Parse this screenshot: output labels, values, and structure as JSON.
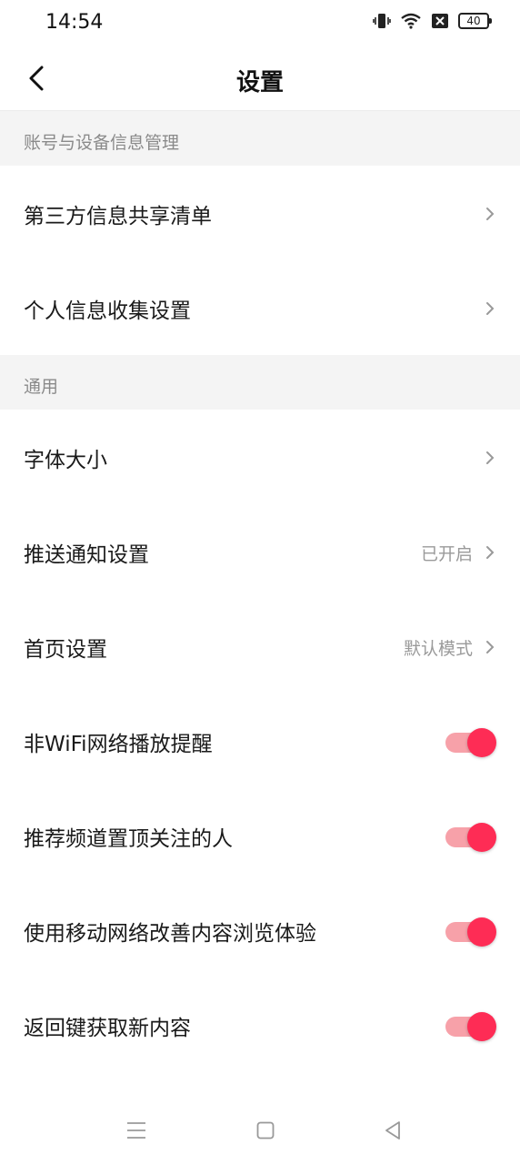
{
  "status_bar": {
    "time": "14:54",
    "battery": "40",
    "icons": [
      "vibrate-icon",
      "wifi-icon",
      "sim-off-icon",
      "battery-icon"
    ]
  },
  "header": {
    "title": "设置",
    "back_icon": "back-arrow-icon"
  },
  "sections": {
    "account": {
      "title": "账号与设备信息管理",
      "items": [
        {
          "label": "第三方信息共享清单"
        },
        {
          "label": "个人信息收集设置"
        }
      ]
    },
    "general": {
      "title": "通用",
      "items": [
        {
          "label": "字体大小",
          "value": ""
        },
        {
          "label": "推送通知设置",
          "value": "已开启"
        },
        {
          "label": "首页设置",
          "value": "默认模式"
        },
        {
          "label": "非WiFi网络播放提醒",
          "toggle": true
        },
        {
          "label": "推荐频道置顶关注的人",
          "toggle": true
        },
        {
          "label": "使用移动网络改善内容浏览体验",
          "toggle": true
        },
        {
          "label": "返回键获取新内容",
          "toggle": true
        }
      ]
    }
  },
  "colors": {
    "accent": "#fe2c55",
    "accent_track": "#f7a1a9",
    "section_bg": "#f4f4f4",
    "secondary_text": "#9a9a9a"
  },
  "nav_bar": {
    "icons": [
      "menu-icon",
      "home-square-icon",
      "back-triangle-icon"
    ]
  }
}
